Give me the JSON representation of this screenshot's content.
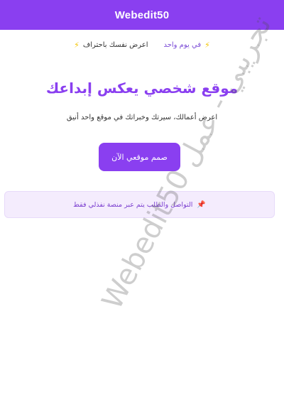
{
  "header": {
    "brand": "Webedit50"
  },
  "features": [
    {
      "icon": "lightning-icon",
      "text": "في يوم واحد"
    },
    {
      "icon": "lightning-icon",
      "text": "اعرض نفسك باحتراف"
    }
  ],
  "hero": {
    "title": "موقع شخصي يعكس إبداعك",
    "subtitle": "اعرض أعمالك، سيرتك وخبراتك في موقع واحد أنيق",
    "cta_label": "صمم موقعي الآن"
  },
  "notice": {
    "icon": "pushpin-icon",
    "text": "التواصل والطلب يتم عبر منصة نفذلي فقط"
  },
  "watermark": {
    "text": "تجريبي - عمل Webedit50"
  },
  "colors": {
    "brand": "#8a3ff0",
    "accent_text": "#7b4bd6",
    "notice_bg": "#f4ecfd",
    "bolt": "#f4c400",
    "pin": "#d8324a"
  }
}
